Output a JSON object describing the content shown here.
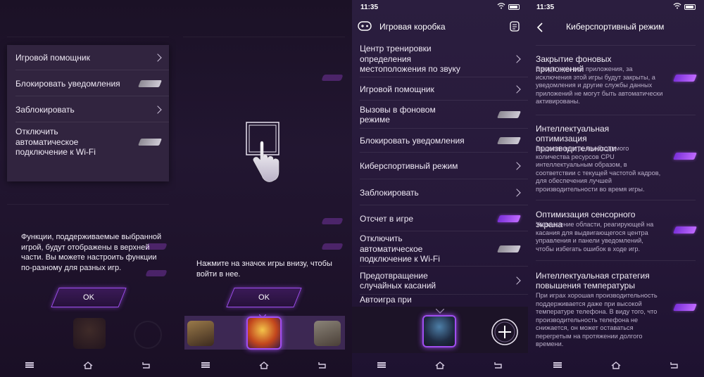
{
  "panel1": {
    "popup": {
      "rows": [
        {
          "label": "Игровой помощник",
          "control": "chevron"
        },
        {
          "label": "Блокировать уведомления",
          "control": "toggle-off"
        },
        {
          "label": "Заблокировать",
          "control": "chevron"
        },
        {
          "label": "Отключить автоматическое подключение к Wi-Fi",
          "control": "toggle-off"
        }
      ]
    },
    "hint": "Функции, поддерживаемые выбранной игрой, будут отображены в верхней части. Вы можете настроить функции по-разному для разных игр.",
    "ok_label": "OK"
  },
  "panel2": {
    "hint": "Нажмите на значок игры внизу, чтобы войти в нее.",
    "ok_label": "OK"
  },
  "panel3": {
    "status": {
      "time": "11:35"
    },
    "title": "Игровая коробка",
    "rows": [
      {
        "label": "Центр тренировки определения местоположения по звуку",
        "control": "chevron"
      },
      {
        "label": "Игровой помощник",
        "control": "chevron"
      },
      {
        "label": "Вызовы в фоновом режиме",
        "control": "toggle-off"
      },
      {
        "label": "Блокировать уведомления",
        "control": "toggle-off"
      },
      {
        "label": "Киберспортивный режим",
        "control": "chevron"
      },
      {
        "label": "Заблокировать",
        "control": "chevron"
      },
      {
        "label": "Отсчет в игре",
        "control": "toggle-on"
      },
      {
        "label": "Отключить автоматическое подключение к Wi-Fi",
        "control": "toggle-off"
      },
      {
        "label": "Предотвращение случайных касаний",
        "control": "chevron"
      },
      {
        "label": "Автоигра при",
        "control": "none"
      }
    ]
  },
  "panel4": {
    "status": {
      "time": "11:35"
    },
    "title": "Киберспортивный режим",
    "sections": [
      {
        "title": "Закрытие фоновых приложений",
        "desc": "В ходе игры все приложения, за исключения этой игры будут закрыты, а уведомления и другие службы данных приложений не могут быть автоматически активированы.",
        "toggle": "on"
      },
      {
        "title": "Интеллектуальная оптимизация производительности",
        "desc": "Выделение игре необходимого количества ресурсов CPU интеллектуальным образом, в соответствии с текущей частотой кадров, для обеспечения лучшей производительности во время игры.",
        "toggle": "on"
      },
      {
        "title": "Оптимизация сенсорного экрана",
        "desc": "Уменьшение области, реагирующей на касания для выдвигающегося центра управления и панели уведомлений, чтобы избегать ошибок в ходе игр.",
        "toggle": "on"
      },
      {
        "title": "Интеллектуальная стратегия повышения температуры",
        "desc": "При играх хорошая производительность поддерживается даже при высокой температуре телефона. В виду того, что производительность телефона не снижается, он может оставаться перегретым на протяжении долгого времени.",
        "toggle": "on"
      }
    ]
  },
  "colors": {
    "accent": "#a04ef0",
    "background": "#2b1e3f"
  },
  "icons": [
    "chevron-right-icon",
    "gamepad-icon",
    "notepad-icon",
    "back-icon",
    "plus-icon",
    "menu-icon",
    "home-icon",
    "return-icon",
    "wifi-icon",
    "battery-icon",
    "hand-tap-icon"
  ]
}
